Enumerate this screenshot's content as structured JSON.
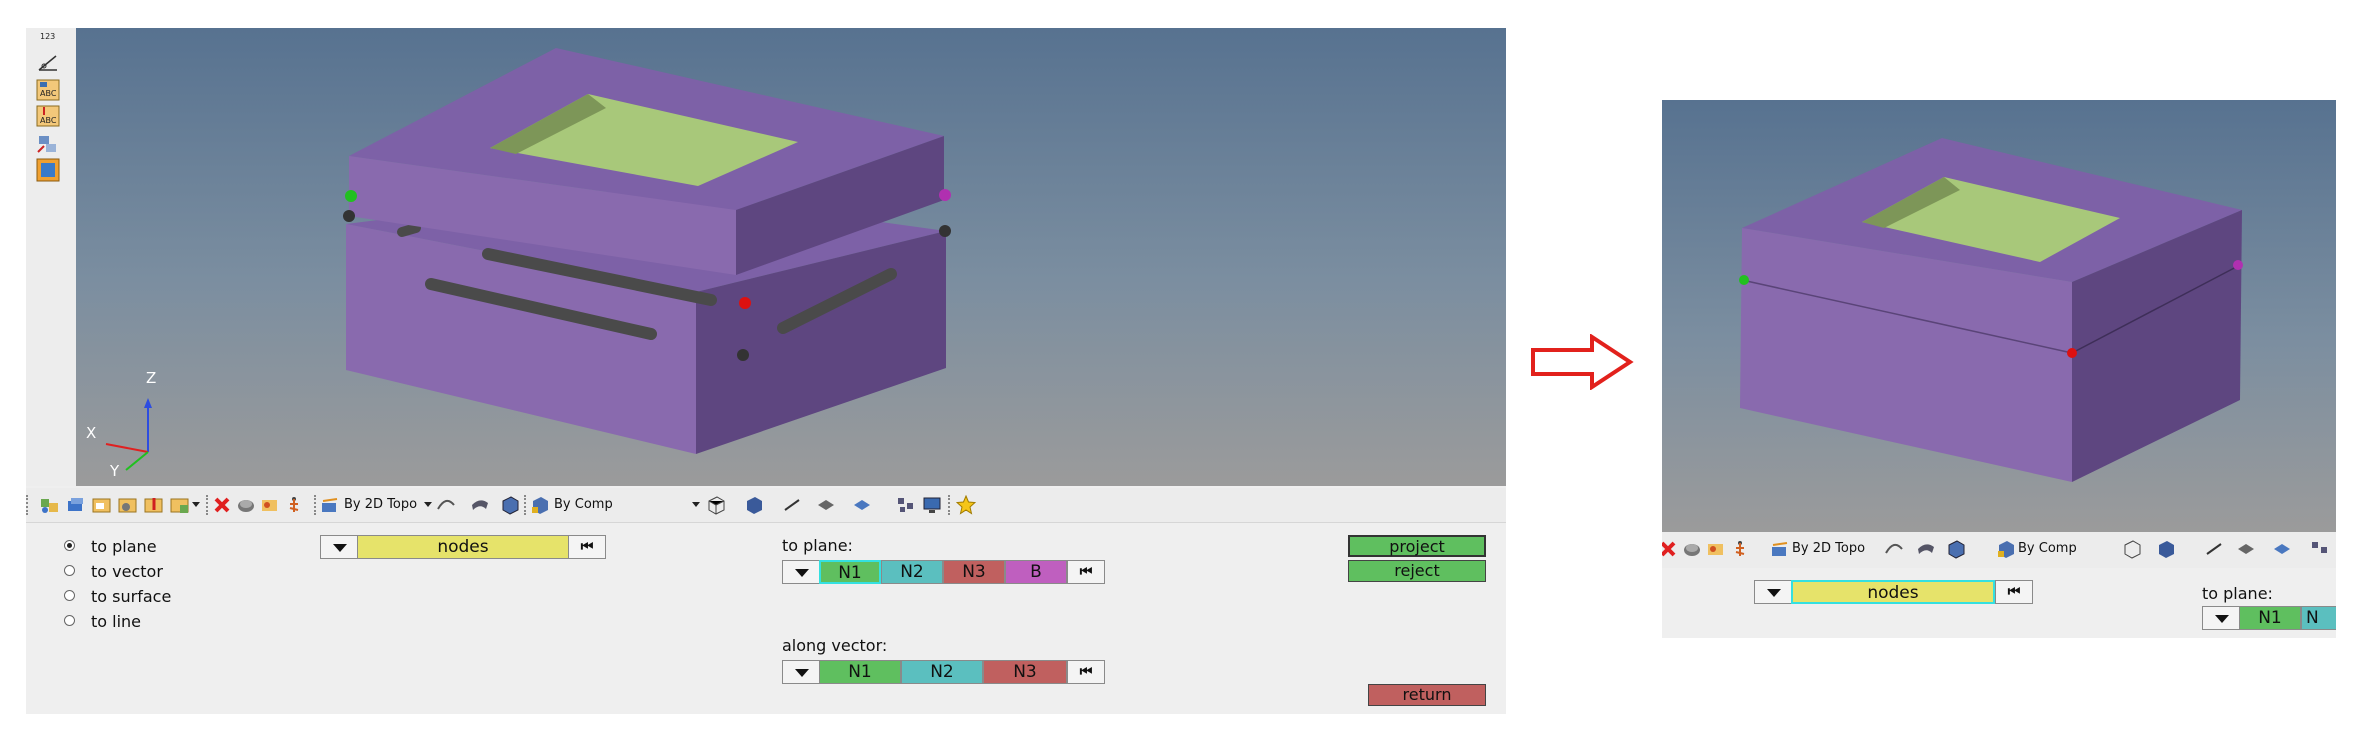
{
  "left": {
    "axis": {
      "z": "Z",
      "x": "X",
      "y": "Y"
    },
    "vert_toolbar": {
      "top_label": "123"
    },
    "toolbar": {
      "topo_label": "By 2D Topo",
      "comp_label": "By Comp",
      "icons": [
        "assembly-icon",
        "component-icon",
        "folder-icon",
        "load-collector-icon",
        "export-icon",
        "import-icon",
        "delete-icon",
        "mask-icon",
        "faces-icon",
        "elements-icon",
        "select-topo-icon",
        "curve-icon",
        "surface-icon",
        "solid-icon",
        "by-comp-icon",
        "wireframe-icon",
        "shaded-icon",
        "line-icon",
        "plane-icon",
        "display-icon",
        "spread-icon",
        "screen-icon",
        "favorite-icon"
      ]
    },
    "panel": {
      "radios": [
        {
          "label": "to plane",
          "selected": true
        },
        {
          "label": "to vector",
          "selected": false
        },
        {
          "label": "to surface",
          "selected": false
        },
        {
          "label": "to line",
          "selected": false
        }
      ],
      "nodes_label": "nodes",
      "to_plane_label": "to plane:",
      "plane_nodes": [
        "N1",
        "N2",
        "N3",
        "B"
      ],
      "along_vector_label": "along vector:",
      "vector_nodes": [
        "N1",
        "N2",
        "N3"
      ],
      "buttons": {
        "project": "project",
        "reject": "reject",
        "return": "return"
      }
    }
  },
  "right": {
    "toolbar": {
      "topo_label": "By 2D Topo",
      "comp_label": "By Comp"
    },
    "panel": {
      "nodes_label": "nodes",
      "to_plane_label": "to plane:",
      "plane_nodes": [
        "N1",
        "N"
      ]
    }
  },
  "colors": {
    "purple_top": "#7d61a7",
    "purple_front": "#896aae",
    "purple_side": "#5e4680",
    "nodes_yellow": "#e6e36a",
    "n1_green": "#5fbf5f",
    "n2_teal": "#5bbfbf",
    "n3_red": "#c0605f",
    "b_magenta": "#bf5fbf",
    "arrow_red": "#e2211c",
    "node_green": "#22c020",
    "node_red": "#dd1111",
    "node_magenta": "#b030b0"
  }
}
